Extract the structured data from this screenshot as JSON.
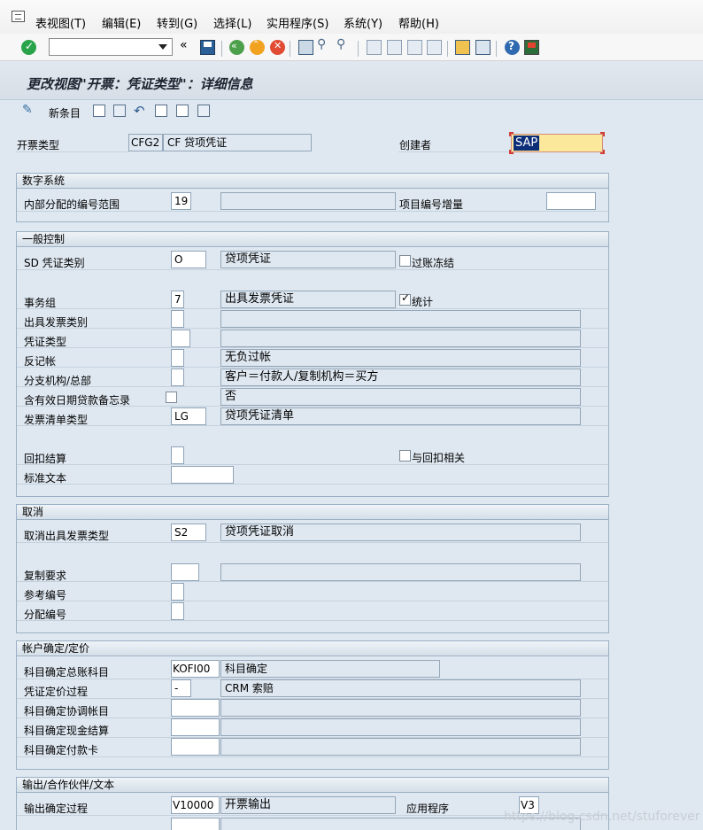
{
  "menubar": {
    "items": [
      "表视图(T)",
      "编辑(E)",
      "转到(G)",
      "选择(L)",
      "实用程序(S)",
      "系统(Y)",
      "帮助(H)"
    ]
  },
  "toolbar": {
    "command_value": "",
    "icons": [
      "enter-icon",
      "command-field",
      "back-icon",
      "save-icon",
      "back-green-icon",
      "exit-icon",
      "cancel-icon",
      "print-icon",
      "find-icon",
      "find-next-icon",
      "first-page-icon",
      "prev-page-icon",
      "next-page-icon",
      "last-page-icon",
      "new-session-icon",
      "shortcut-icon",
      "help-icon",
      "layout-icon"
    ]
  },
  "title": "更改视图\"开票：凭证类型\"：详细信息",
  "app_toolbar": {
    "new_entries": "新条目"
  },
  "header": {
    "billing_type_label": "开票类型",
    "billing_type": "CFG2",
    "billing_type_desc": "CF 贷项凭证",
    "created_by_label": "创建者",
    "created_by": "SAP"
  },
  "numbering": {
    "title": "数字系统",
    "internal_range_label": "内部分配的编号范围",
    "internal_range": "19",
    "item_increment_label": "项目编号增量",
    "item_increment": ""
  },
  "general": {
    "title": "一般控制",
    "sd_category_label": "SD 凭证类别",
    "sd_category": "O",
    "sd_category_desc": "贷项凭证",
    "posting_block_label": "过账冻结",
    "transaction_group_label": "事务组",
    "transaction_group": "7",
    "transaction_group_desc": "出具发票凭证",
    "statistics_label": "统计",
    "billing_type_label": "出具发票类别",
    "doc_type_label": "凭证类型",
    "negative_posting_label": "反记帐",
    "negative_posting_desc": "无负过帐",
    "branch_label": "分支机构/总部",
    "branch_desc": "客户＝付款人/复制机构＝买方",
    "credit_memo_label": "含有效日期贷款备忘录",
    "credit_memo_desc": "否",
    "invoice_list_label": "发票清单类型",
    "invoice_list": "LG",
    "invoice_list_desc": "贷项凭证清单",
    "rebate_label": "回扣结算",
    "rebate_relevant_label": "与回扣相关",
    "std_text_label": "标准文本"
  },
  "cancel": {
    "title": "取消",
    "cancel_type_label": "取消出具发票类型",
    "cancel_type": "S2",
    "cancel_type_desc": "贷项凭证取消",
    "copy_req_label": "复制要求",
    "ref_number_label": "参考编号",
    "assign_number_label": "分配编号"
  },
  "account": {
    "title": "帐户确定/定价",
    "gl_proc_label": "科目确定总账科目",
    "gl_proc": "KOFI00",
    "gl_proc_desc": "科目确定",
    "pricing_label": "凭证定价过程",
    "pricing": "-",
    "pricing_desc": "CRM 索赔",
    "reconcile_label": "科目确定协调帐目",
    "cash_label": "科目确定现金结算",
    "card_label": "科目确定付款卡"
  },
  "output": {
    "title": "输出/合作伙伴/文本",
    "output_proc_label": "输出确定过程",
    "output_proc": "V10000",
    "output_proc_desc": "开票输出",
    "application_label": "应用程序",
    "application": "V3"
  },
  "watermark": "https://blog.csdn.net/stuforever"
}
